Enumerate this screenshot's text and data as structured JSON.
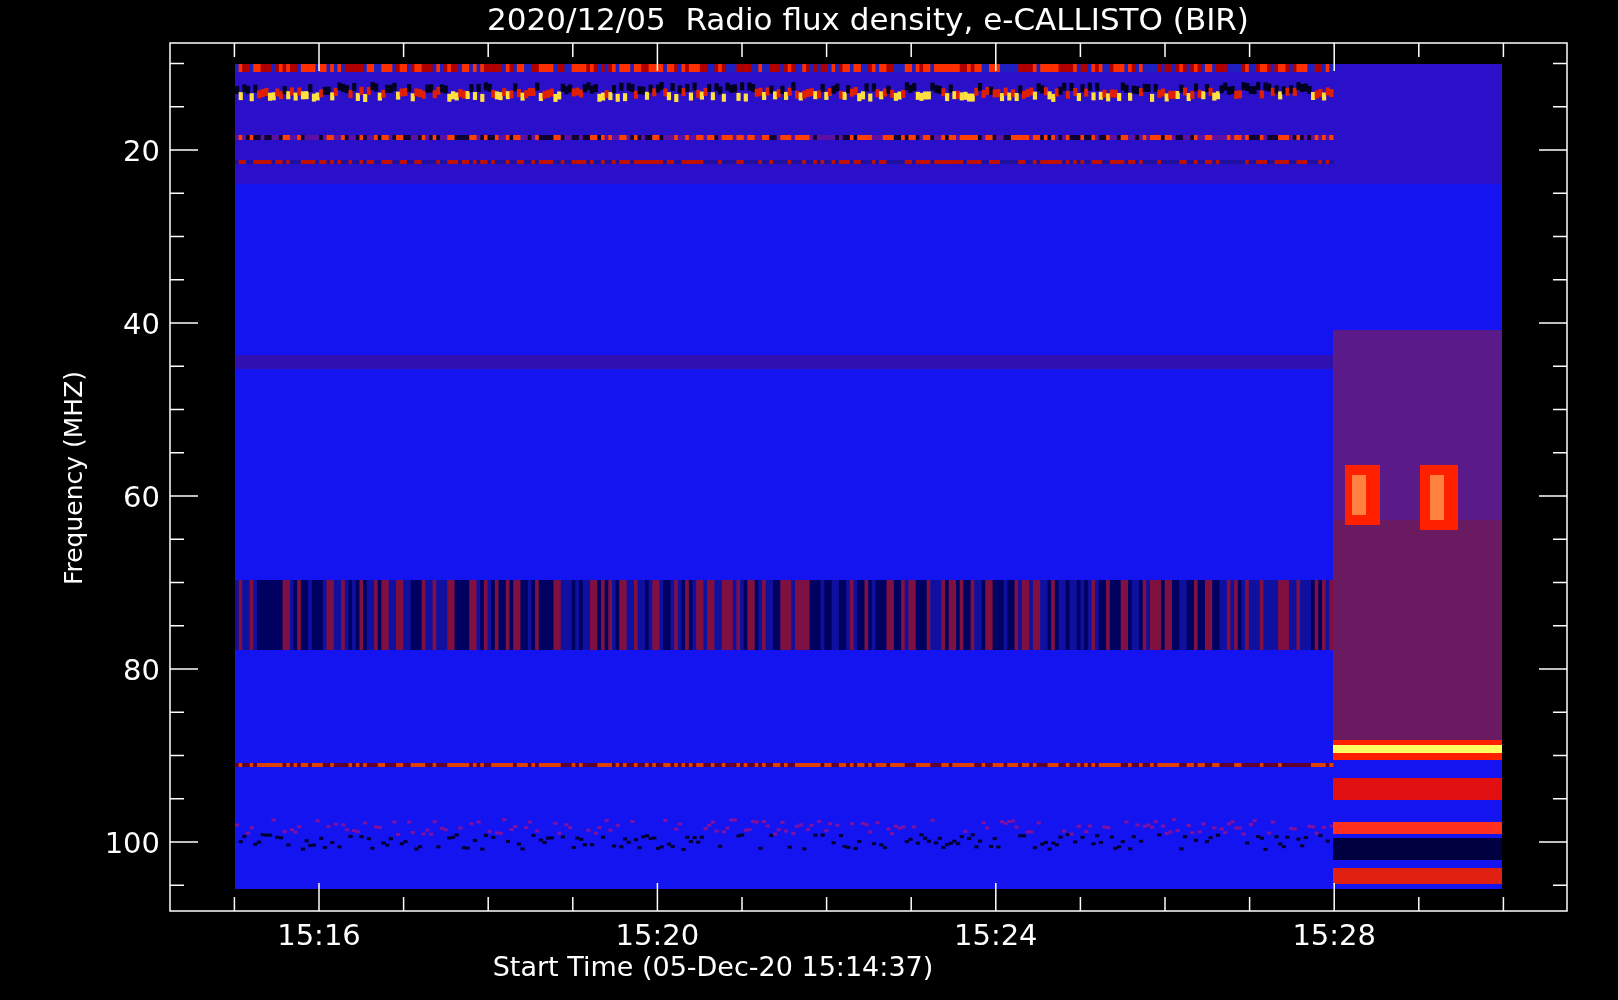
{
  "title": "2020/12/05  Radio flux density, e-CALLISTO (BIR)",
  "y_axis": {
    "label": "Frequency (MHZ)",
    "ticks": [
      "20",
      "40",
      "60",
      "80",
      "100"
    ]
  },
  "x_axis": {
    "label": "Start Time (05-Dec-20 15:14:37)",
    "ticks": [
      "15:16",
      "15:20",
      "15:24",
      "15:28"
    ]
  }
}
